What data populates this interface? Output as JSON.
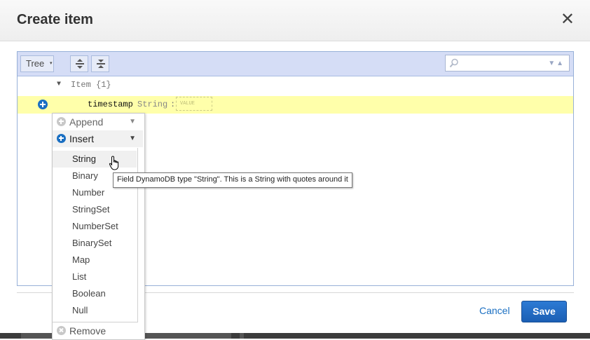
{
  "dialog": {
    "title": "Create item",
    "close_glyph": "✕"
  },
  "toolbar": {
    "mode_label": "Tree",
    "mode_caret": "▾",
    "expand_icon": "expand-all-icon",
    "collapse_icon": "collapse-all-icon",
    "search_placeholder": "",
    "search_nav_glyphs": "▼▲"
  },
  "tree": {
    "root_expander": "▼",
    "root_label": "Item {1}",
    "field": {
      "name": "timestamp",
      "type": "String",
      "separator": ":",
      "value_placeholder": "VALUE"
    }
  },
  "context_menu": {
    "append_label": "Append",
    "insert_label": "Insert",
    "remove_label": "Remove",
    "arrow_glyph": "▼",
    "insert_types": [
      "String",
      "Binary",
      "Number",
      "StringSet",
      "NumberSet",
      "BinarySet",
      "Map",
      "List",
      "Boolean",
      "Null"
    ]
  },
  "tooltip": "Field DynamoDB type \"String\". This is a String with quotes around it",
  "footer": {
    "cancel_label": "Cancel",
    "save_label": "Save"
  },
  "colors": {
    "accent": "#1a6fc2",
    "toolbar_bg": "#d5ddf6",
    "row_highlight": "#ffffaa"
  }
}
